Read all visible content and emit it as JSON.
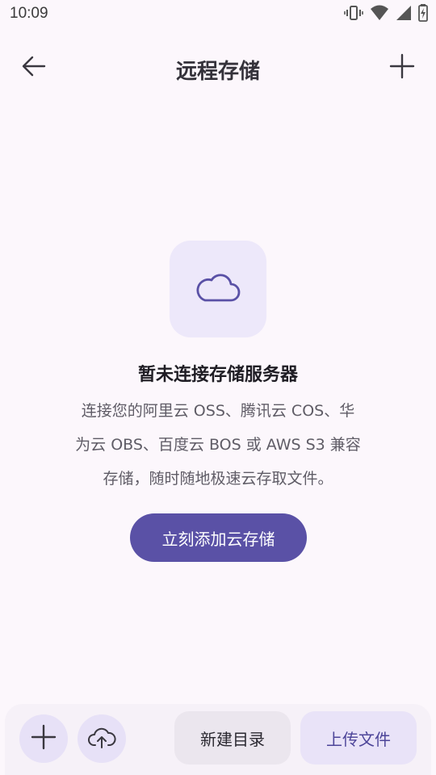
{
  "status_bar": {
    "time": "10:09",
    "icons": [
      "vibrate-icon",
      "wifi-icon",
      "signal-icon",
      "battery-charging-icon"
    ]
  },
  "app_bar": {
    "title": "远程存储",
    "back_icon": "arrow-left-icon",
    "add_icon": "plus-icon"
  },
  "empty_state": {
    "icon": "cloud-icon",
    "title": "暂未连接存储服务器",
    "description_lines": [
      "连接您的阿里云 OSS、腾讯云 COS、华",
      "为云 OBS、百度云 BOS 或 AWS S3 兼容",
      "存储，随时随地极速云存取文件。"
    ],
    "button_label": "立刻添加云存储"
  },
  "bottom_bar": {
    "add_icon": "plus-icon",
    "upload_icon": "cloud-upload-icon",
    "new_folder_label": "新建目录",
    "upload_label": "上传文件"
  },
  "colors": {
    "background": "#fcf7fc",
    "accent": "#5a51a6",
    "tile": "#ede8fa"
  }
}
